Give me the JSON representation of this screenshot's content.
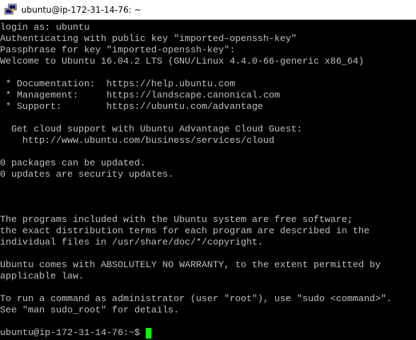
{
  "window": {
    "title": "ubuntu@ip-172-31-14-76: ~"
  },
  "terminal": {
    "lines": [
      "login as: ubuntu",
      "Authenticating with public key \"imported-openssh-key\"",
      "Passphrase for key \"imported-openssh-key\":",
      "Welcome to Ubuntu 16.04.2 LTS (GNU/Linux 4.4.0-66-generic x86_64)",
      "",
      " * Documentation:  https://help.ubuntu.com",
      " * Management:     https://landscape.canonical.com",
      " * Support:        https://ubuntu.com/advantage",
      "",
      "  Get cloud support with Ubuntu Advantage Cloud Guest:",
      "    http://www.ubuntu.com/business/services/cloud",
      "",
      "0 packages can be updated.",
      "0 updates are security updates.",
      "",
      "",
      "",
      "The programs included with the Ubuntu system are free software;",
      "the exact distribution terms for each program are described in the",
      "individual files in /usr/share/doc/*/copyright.",
      "",
      "Ubuntu comes with ABSOLUTELY NO WARRANTY, to the extent permitted by",
      "applicable law.",
      "",
      "To run a command as administrator (user \"root\"), use \"sudo <command>\".",
      "See \"man sudo_root\" for details.",
      ""
    ],
    "prompt": "ubuntu@ip-172-31-14-76:~$ ",
    "text_color": "#c0c0c0",
    "cursor_color": "#00ff00",
    "background_color": "#000000"
  },
  "icons": {
    "app_icon": "putty-icon"
  }
}
